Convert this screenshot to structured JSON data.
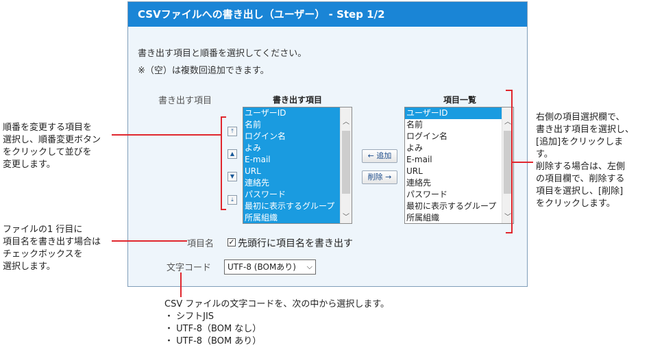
{
  "title": "CSVファイルへの書き出し（ユーザー） - Step 1/2",
  "description": {
    "line1": "書き出す項目と順番を選択してください。",
    "line2": "※（空）は複数回追加できます。"
  },
  "export_fields_label": "書き出す項目",
  "left_list": {
    "header": "書き出す項目",
    "items": [
      "ユーザーID",
      "名前",
      "ログイン名",
      "よみ",
      "E-mail",
      "URL",
      "連絡先",
      "パスワード",
      "最初に表示するグループ",
      "所属組織"
    ]
  },
  "right_list": {
    "header": "項目一覧",
    "items": [
      "ユーザーID",
      "名前",
      "ログイン名",
      "よみ",
      "E-mail",
      "URL",
      "連絡先",
      "パスワード",
      "最初に表示するグループ",
      "所属組織"
    ],
    "highlighted": "ユーザーID"
  },
  "order_buttons": {
    "top_icon": "move-to-top-icon",
    "up_icon": "move-up-icon",
    "down_icon": "move-down-icon",
    "bottom_icon": "move-to-bottom-icon"
  },
  "add_button": "← 追加",
  "remove_button": "削除 →",
  "field_name_label": "項目名",
  "header_checkbox_label": "先頭行に項目名を書き出す",
  "header_checkbox_checked": true,
  "encoding_label": "文字コード",
  "encoding_value": "UTF-8 (BOMあり)",
  "annotations": {
    "order_note": [
      "順番を変更する項目を",
      "選択し、順番変更ボタン",
      "をクリックして並びを",
      "変更します。"
    ],
    "checkbox_note": [
      "ファイルの1 行目に",
      "項目名を書き出す場合は",
      "チェックボックスを",
      "選択します。"
    ],
    "right_note": [
      "右側の項目選択欄で、",
      "書き出す項目を選択し、",
      "[追加]をクリックしま",
      "す。",
      "削除する場合は、左側",
      "の項目欄で、削除する",
      "項目を選択し、[削除]",
      "をクリックします。"
    ],
    "encoding_note": [
      "CSV ファイルの文字コードを、次の中から選択します。",
      "・ シフトJIS",
      "・ UTF-8（BOM なし）",
      "・ UTF-8（BOM あり）"
    ]
  },
  "colors": {
    "title_bar": "#1a85d6",
    "selection": "#1a9be0",
    "annotation_line": "#e0262d",
    "panel_bg": "#eef5fb"
  }
}
